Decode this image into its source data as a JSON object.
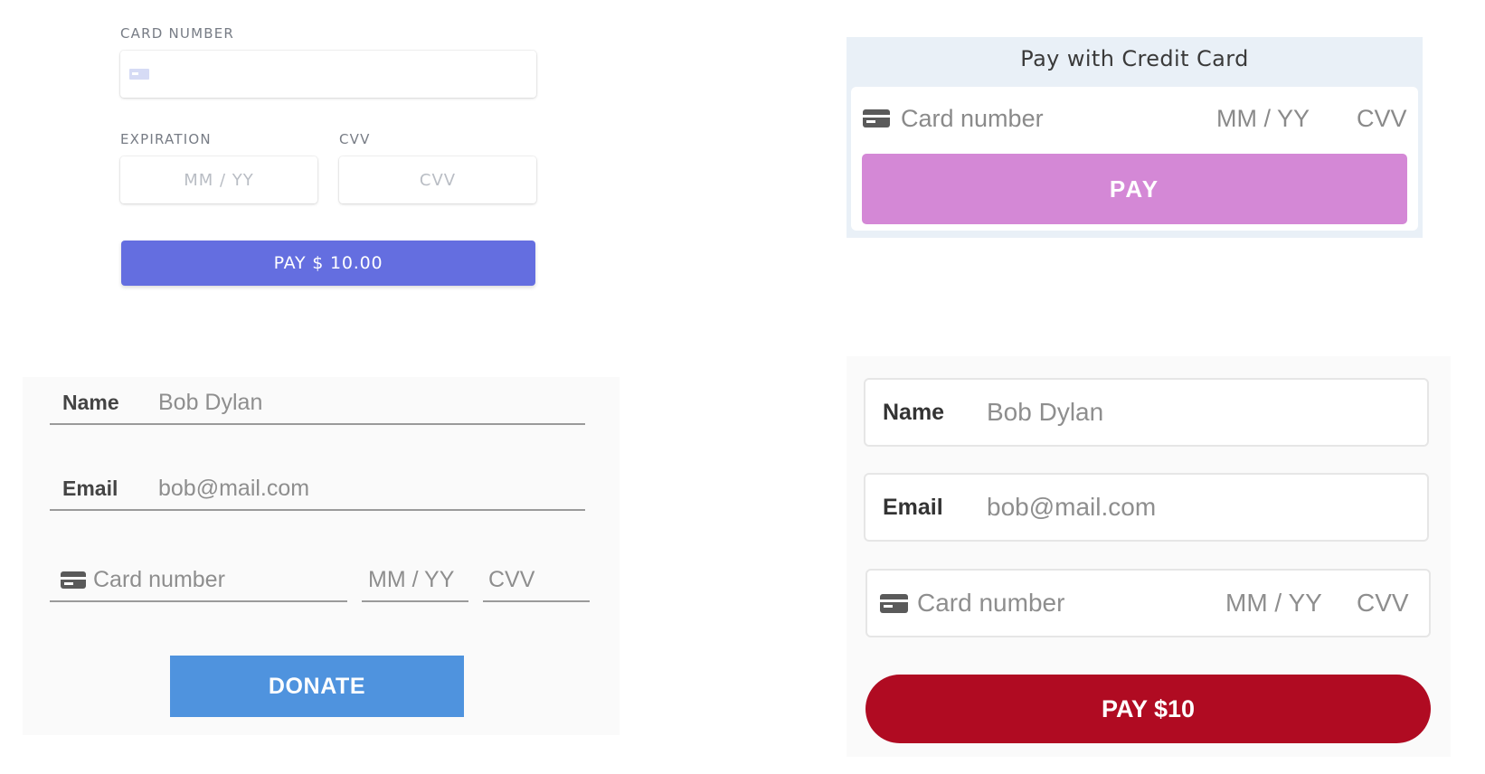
{
  "panel_1": {
    "card_number_label": "CARD NUMBER",
    "card_number_value": "",
    "expiration_label": "EXPIRATION",
    "expiration_placeholder": "MM / YY",
    "cvv_label": "CVV",
    "cvv_placeholder": "CVV",
    "pay_button": "PAY $ 10.00",
    "button_color": "#646ee0"
  },
  "panel_2": {
    "title": "Pay with Credit Card",
    "card_number_placeholder": "Card number",
    "expiry_placeholder": "MM / YY",
    "cvv_placeholder": "CVV",
    "pay_button": "PAY",
    "button_color": "#d488d6",
    "background_color": "#e9f0f7"
  },
  "panel_3": {
    "name_label": "Name",
    "name_placeholder": "Bob Dylan",
    "email_label": "Email",
    "email_placeholder": "bob@mail.com",
    "card_number_placeholder": "Card number",
    "expiry_placeholder": "MM / YY",
    "cvv_placeholder": "CVV",
    "donate_button": "DONATE",
    "button_color": "#4f93de"
  },
  "panel_4": {
    "name_label": "Name",
    "name_placeholder": "Bob Dylan",
    "email_label": "Email",
    "email_placeholder": "bob@mail.com",
    "card_number_placeholder": "Card number",
    "expiry_placeholder": "MM / YY",
    "cvv_placeholder": "CVV",
    "pay_button": "PAY $10",
    "button_color": "#b00b22"
  },
  "icons": {
    "card": "credit-card-icon"
  }
}
